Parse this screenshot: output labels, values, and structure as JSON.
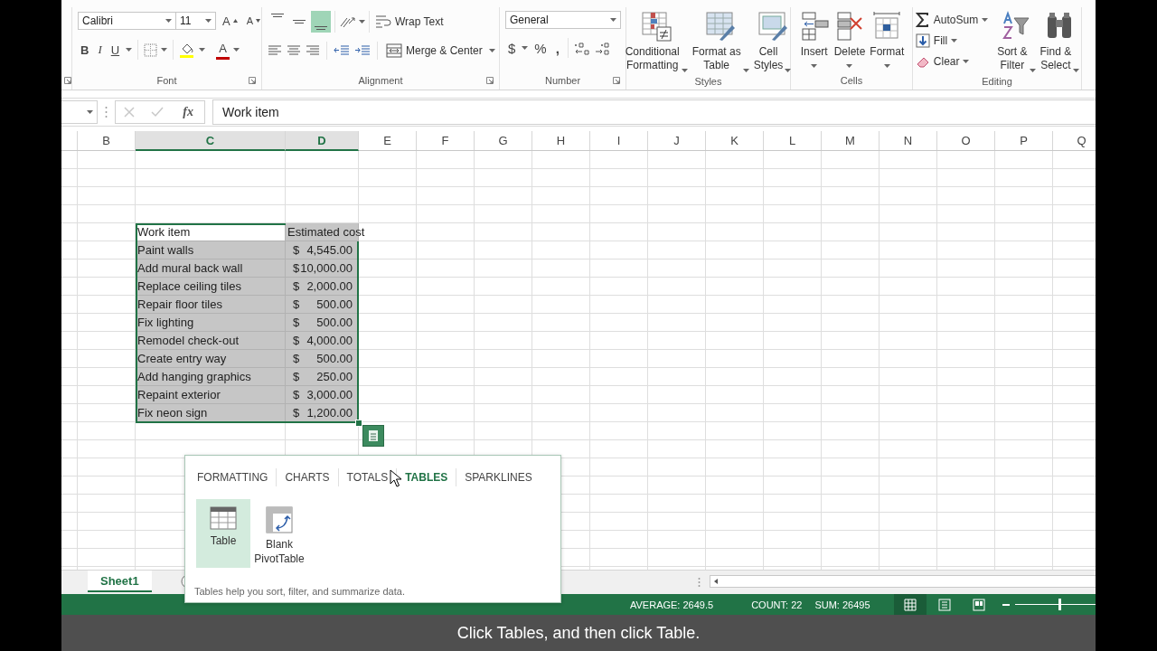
{
  "ribbon": {
    "font": {
      "label": "Font",
      "font_name": "Calibri",
      "font_size": "11",
      "grow_font": "A",
      "shrink_font": "A",
      "bold": "B",
      "italic": "I",
      "underline": "U",
      "font_color": "A"
    },
    "alignment": {
      "label": "Alignment",
      "vertical": [
        {
          "kind": "top",
          "selected": false
        },
        {
          "kind": "middle",
          "selected": false
        },
        {
          "kind": "bottom",
          "selected": true
        }
      ],
      "wrap_text": "Wrap Text",
      "merge_center": "Merge & Center"
    },
    "number": {
      "label": "Number",
      "format": "General",
      "currency": "$",
      "percent": "%",
      "comma": ","
    },
    "styles": {
      "label": "Styles",
      "buttons": [
        {
          "kind": "conditional",
          "label": "Conditional\nFormatting"
        },
        {
          "kind": "format_table",
          "label": "Format as\nTable"
        },
        {
          "kind": "cell_styles",
          "label": "Cell\nStyles"
        }
      ]
    },
    "cells": {
      "label": "Cells",
      "buttons": [
        {
          "kind": "insert",
          "label": "Insert"
        },
        {
          "kind": "delete",
          "label": "Delete"
        },
        {
          "kind": "format",
          "label": "Format"
        }
      ]
    },
    "editing": {
      "label": "Editing",
      "small": [
        {
          "kind": "autosum",
          "label": "AutoSum"
        },
        {
          "kind": "fill",
          "label": "Fill"
        },
        {
          "kind": "clear",
          "label": "Clear"
        }
      ],
      "buttons": [
        {
          "kind": "sort",
          "label": "Sort &\nFilter"
        },
        {
          "kind": "find",
          "label": "Find &\nSelect"
        }
      ]
    }
  },
  "formula_bar": {
    "cancel": {
      "disabled": true
    },
    "enter": {
      "disabled": true
    },
    "fx": "fx",
    "value": "Work item"
  },
  "columns": [
    {
      "label": "B",
      "selected": false
    },
    {
      "label": "C",
      "selected": true
    },
    {
      "label": "D",
      "selected": true
    },
    {
      "label": "E",
      "selected": false
    },
    {
      "label": "F",
      "selected": false
    },
    {
      "label": "G",
      "selected": false
    },
    {
      "label": "H",
      "selected": false
    },
    {
      "label": "I",
      "selected": false
    },
    {
      "label": "J",
      "selected": false
    },
    {
      "label": "K",
      "selected": false
    },
    {
      "label": "L",
      "selected": false
    },
    {
      "label": "M",
      "selected": false
    },
    {
      "label": "N",
      "selected": false
    },
    {
      "label": "O",
      "selected": false
    },
    {
      "label": "P",
      "selected": false
    },
    {
      "label": "Q",
      "selected": false
    }
  ],
  "table": {
    "selected": true,
    "header": [
      "Work item",
      "Estimated cost"
    ],
    "rows": [
      {
        "item": "Paint walls",
        "currency": "$",
        "amount": "4,545.00"
      },
      {
        "item": "Add mural back wall",
        "currency": "$",
        "amount": "10,000.00"
      },
      {
        "item": "Replace ceiling tiles",
        "currency": "$",
        "amount": "2,000.00"
      },
      {
        "item": "Repair floor tiles",
        "currency": "$",
        "amount": "500.00"
      },
      {
        "item": "Fix lighting",
        "currency": "$",
        "amount": "500.00"
      },
      {
        "item": "Remodel check-out",
        "currency": "$",
        "amount": "4,000.00"
      },
      {
        "item": "Create entry way",
        "currency": "$",
        "amount": "500.00"
      },
      {
        "item": "Add hanging graphics",
        "currency": "$",
        "amount": "250.00"
      },
      {
        "item": "Repaint exterior",
        "currency": "$",
        "amount": "3,000.00"
      },
      {
        "item": "Fix neon sign",
        "currency": "$",
        "amount": "1,200.00"
      }
    ]
  },
  "quick_analysis": {
    "tabs": [
      {
        "label": "FORMATTING",
        "selected": false
      },
      {
        "label": "CHARTS",
        "selected": false
      },
      {
        "label": "TOTALS",
        "selected": false
      },
      {
        "label": "TABLES",
        "selected": true
      },
      {
        "label": "SPARKLINES",
        "selected": false
      }
    ],
    "options": [
      {
        "kind": "table",
        "label": "Table",
        "selected": true
      },
      {
        "kind": "pivot",
        "label": "Blank\nPivotTable",
        "selected": false
      }
    ],
    "description": "Tables help you sort, filter, and summarize data."
  },
  "sheet_tabs": [
    {
      "label": "Sheet1",
      "selected": true
    }
  ],
  "status_bar": {
    "average": "AVERAGE: 2649.5",
    "count": "COUNT: 22",
    "sum": "SUM: 26495",
    "views": [
      {
        "kind": "normal",
        "selected": true
      },
      {
        "kind": "page_layout",
        "selected": false
      },
      {
        "kind": "page_break",
        "selected": false
      }
    ],
    "zoom": {
      "level": 0.48
    }
  },
  "caption": "Click Tables, and then click Table."
}
